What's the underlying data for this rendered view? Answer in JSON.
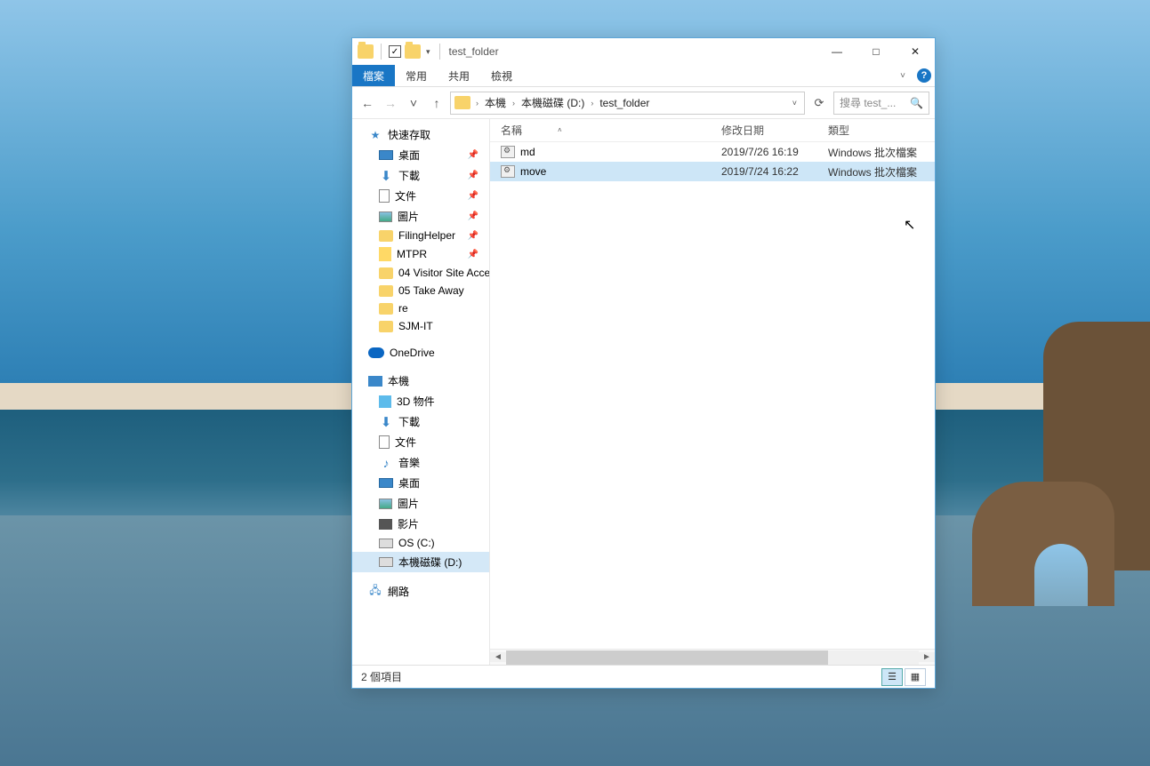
{
  "window": {
    "title": "test_folder",
    "controls": {
      "min": "—",
      "max": "□",
      "close": "✕"
    }
  },
  "ribbon": {
    "file": "檔案",
    "tabs": [
      "常用",
      "共用",
      "檢視"
    ],
    "expand": "˅",
    "help": "?"
  },
  "nav": {
    "back": "←",
    "forward": "→",
    "recent": "˅",
    "up": "↑",
    "refresh": "⟳"
  },
  "address": {
    "segments": [
      "本機",
      "本機磁碟 (D:)",
      "test_folder"
    ],
    "chevron": "›"
  },
  "search": {
    "placeholder": "搜尋 test_..."
  },
  "sidebar": {
    "quick_access": "快速存取",
    "quick_items": [
      {
        "label": "桌面",
        "icon": "desktop",
        "pinned": true
      },
      {
        "label": "下載",
        "icon": "download",
        "pinned": true
      },
      {
        "label": "文件",
        "icon": "doc",
        "pinned": true
      },
      {
        "label": "圖片",
        "icon": "pic",
        "pinned": true
      },
      {
        "label": "FilingHelper",
        "icon": "folder",
        "pinned": true
      },
      {
        "label": "MTPR",
        "icon": "mtpr",
        "pinned": true
      },
      {
        "label": "04 Visitor Site Acce",
        "icon": "folder",
        "pinned": false
      },
      {
        "label": "05 Take Away",
        "icon": "folder",
        "pinned": false
      },
      {
        "label": "re",
        "icon": "folder",
        "pinned": false
      },
      {
        "label": "SJM-IT",
        "icon": "folder",
        "pinned": false
      }
    ],
    "onedrive": "OneDrive",
    "this_pc": "本機",
    "pc_items": [
      {
        "label": "3D 物件",
        "icon": "3d"
      },
      {
        "label": "下載",
        "icon": "download"
      },
      {
        "label": "文件",
        "icon": "doc"
      },
      {
        "label": "音樂",
        "icon": "music"
      },
      {
        "label": "桌面",
        "icon": "desktop"
      },
      {
        "label": "圖片",
        "icon": "pic"
      },
      {
        "label": "影片",
        "icon": "video"
      },
      {
        "label": "OS (C:)",
        "icon": "drive"
      },
      {
        "label": "本機磁碟 (D:)",
        "icon": "drive",
        "selected": true
      }
    ],
    "network": "網路"
  },
  "columns": {
    "name": "名稱",
    "date": "修改日期",
    "type": "類型"
  },
  "files": [
    {
      "name": "md",
      "date": "2019/7/26 16:19",
      "type": "Windows 批次檔案",
      "selected": false
    },
    {
      "name": "move",
      "date": "2019/7/24 16:22",
      "type": "Windows 批次檔案",
      "selected": true
    }
  ],
  "status": {
    "count": "2 個項目"
  }
}
